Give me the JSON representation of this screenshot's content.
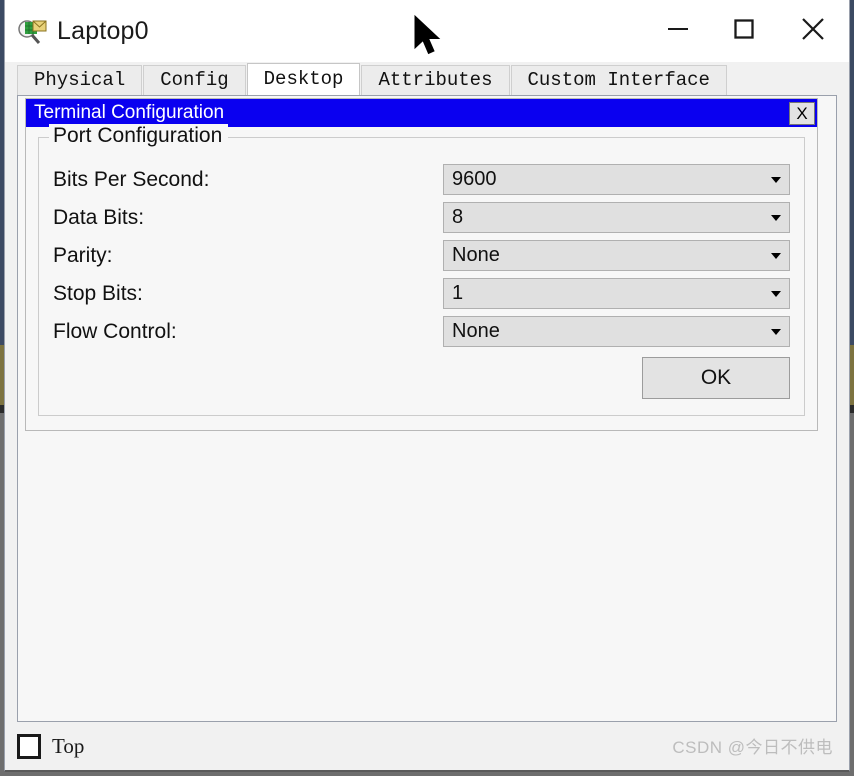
{
  "window": {
    "title": "Laptop0",
    "icon": "inspect-packet-icon",
    "controls": {
      "minimize": "minimize-icon",
      "maximize": "maximize-icon",
      "close": "close-icon"
    }
  },
  "tabs": [
    {
      "label": "Physical",
      "active": false
    },
    {
      "label": "Config",
      "active": false
    },
    {
      "label": "Desktop",
      "active": true
    },
    {
      "label": "Attributes",
      "active": false
    },
    {
      "label": "Custom Interface",
      "active": false
    }
  ],
  "dialog": {
    "title": "Terminal Configuration",
    "close_label": "X",
    "title_bg": "#0a00f0",
    "title_fg": "#ffffff",
    "group": {
      "legend": "Port Configuration",
      "fields": [
        {
          "label": "Bits Per Second:",
          "value": "9600",
          "name": "bits-per-second"
        },
        {
          "label": "Data Bits:",
          "value": "8",
          "name": "data-bits"
        },
        {
          "label": "Parity:",
          "value": "None",
          "name": "parity"
        },
        {
          "label": "Stop Bits:",
          "value": "1",
          "name": "stop-bits"
        },
        {
          "label": "Flow Control:",
          "value": "None",
          "name": "flow-control"
        }
      ],
      "ok_label": "OK"
    }
  },
  "footer": {
    "top_checkbox_label": "Top",
    "top_checkbox_checked": false,
    "watermark": "CSDN @今日不供电"
  }
}
